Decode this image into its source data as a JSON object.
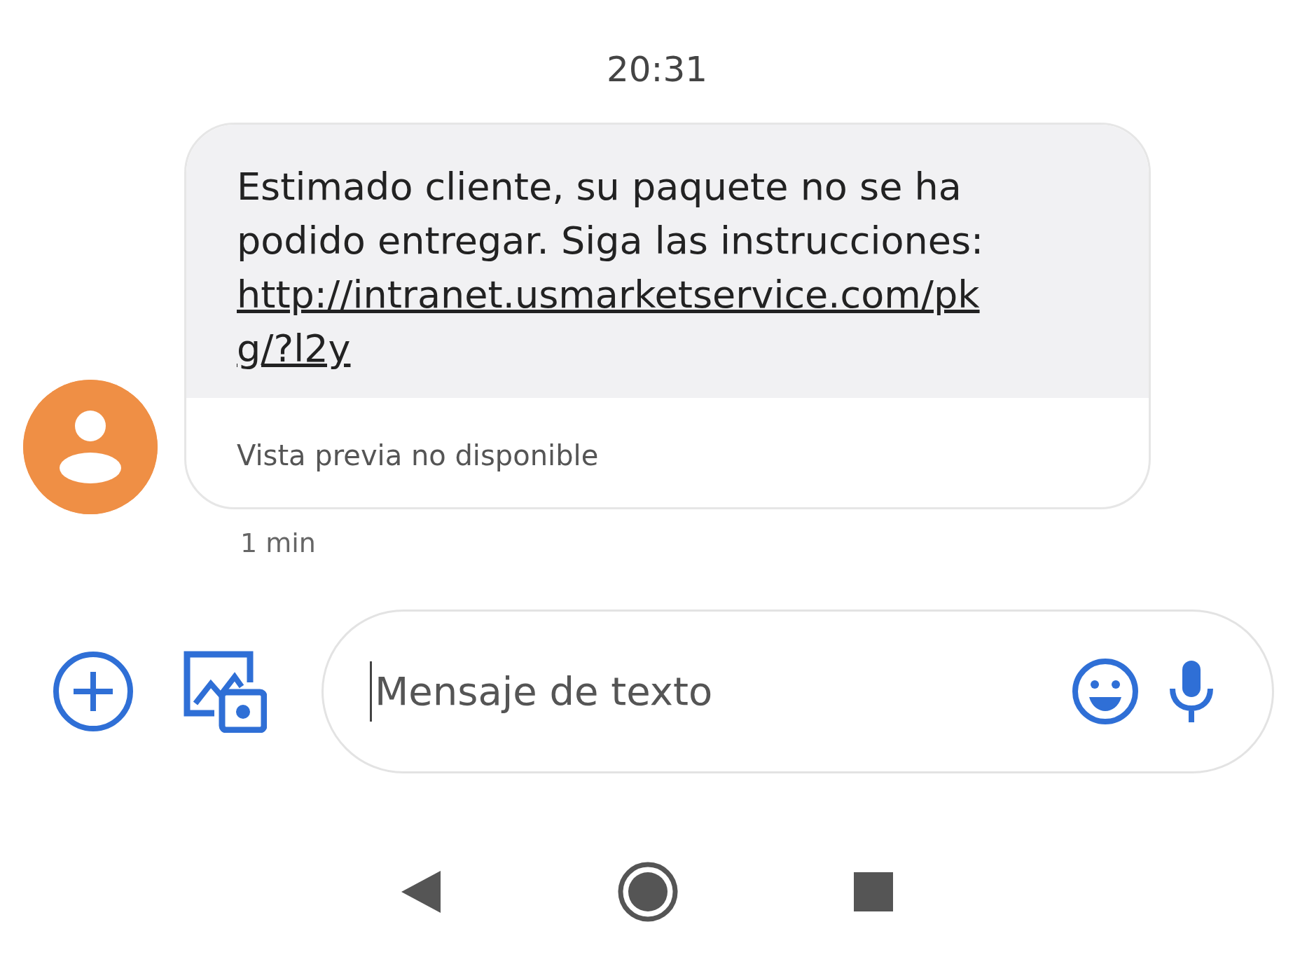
{
  "status": {
    "time": "20:31"
  },
  "message": {
    "text": "Estimado cliente, su paquete no se ha podido entregar. Siga las instrucciones:",
    "link": "http://intranet.usmarketservice.com/pkg/?l2y",
    "preview": "Vista previa no disponible",
    "age": "1 min"
  },
  "composer": {
    "placeholder": "Mensaje de texto"
  }
}
